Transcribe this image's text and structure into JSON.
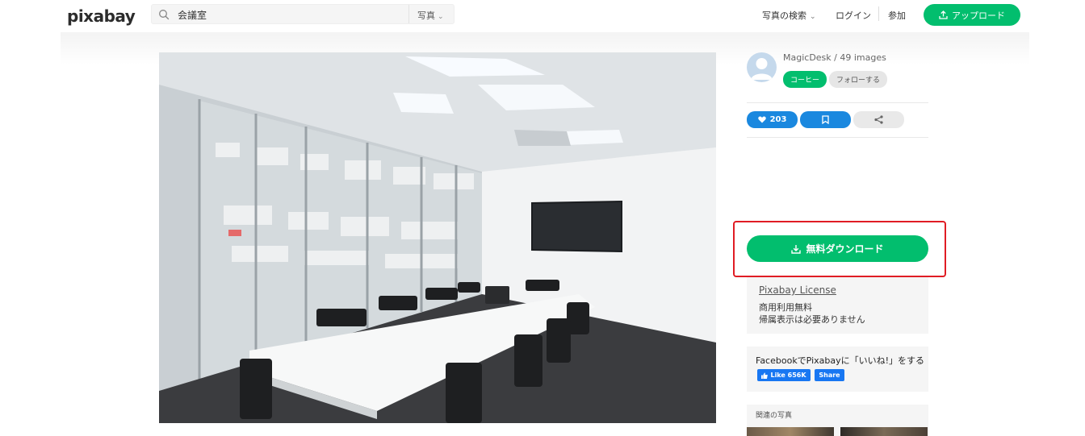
{
  "header": {
    "logo": "pixabay",
    "search": {
      "value": "会議室",
      "type_label": "写真"
    },
    "nav": {
      "explore": "写真の検索",
      "login": "ログイン",
      "join": "参加"
    },
    "upload_label": "アップロード"
  },
  "photo": {
    "subject": "conference-room"
  },
  "sidebar": {
    "author": "MagicDesk / 49 images",
    "coffee_label": "コーヒー",
    "follow_label": "フォローする",
    "like_count": "203",
    "download_label": "無料ダウンロード",
    "license": {
      "link": "Pixabay License",
      "line1": "商用利用無料",
      "line2": "帰属表示は必要ありません"
    },
    "facebook": {
      "text": "FacebookでPixabayに「いいね!」をする",
      "like_label": "Like 656K",
      "share_label": "Share"
    },
    "related_title": "関連の写真"
  },
  "colors": {
    "brand_green": "#02be6e",
    "action_blue": "#1a88df",
    "highlight_red": "#e01c24",
    "facebook_blue": "#1877f2"
  }
}
